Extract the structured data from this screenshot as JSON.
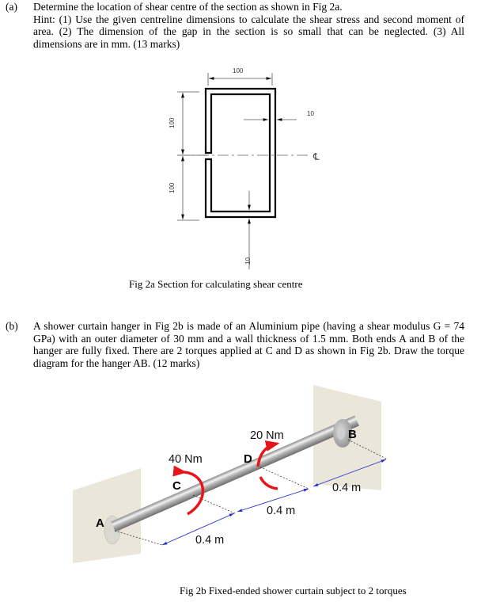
{
  "part_a": {
    "number": "(a)",
    "lines": [
      "Determine the location of shear centre of the section as shown in Fig 2a.",
      "Hint: (1) Use the given centreline dimensions to calculate the shear stress and second moment of area.  (2) The dimension of the gap in the section is so small that can be neglected. (3) All dimensions are in mm. (13 marks)"
    ],
    "figure": {
      "dim_width": "100",
      "dim_upper_height": "100",
      "dim_lower_height": "100",
      "dim_wall_right": "10",
      "dim_wall_bottom": "10",
      "centreline_symbol": "℄"
    },
    "caption": "Fig 2a Section for calculating shear centre"
  },
  "part_b": {
    "number": "(b)",
    "text": "A shower curtain hanger in Fig 2b is made of an Aluminium pipe (having a shear modulus G = 74 GPa) with an outer diameter of 30 mm and a wall thickness of 1.5 mm. Both ends A and B of the hanger are fully fixed.  There are 2 torques applied at C and D as shown in Fig 2b.  Draw the torque diagram for the hanger AB. (12 marks)",
    "figure": {
      "point_a": "A",
      "point_b": "B",
      "point_c": "C",
      "point_d": "D",
      "torque_c": "40 Nm",
      "torque_d": "20 Nm",
      "len_ac": "0.4 m",
      "len_cd": "0.4 m",
      "len_db": "0.4 m",
      "torque_color": "#e8141b",
      "dimension_color": "#2030c8",
      "wall_color": "#ebe6da"
    },
    "caption": "Fig 2b Fixed-ended shower curtain subject to 2 torques"
  }
}
